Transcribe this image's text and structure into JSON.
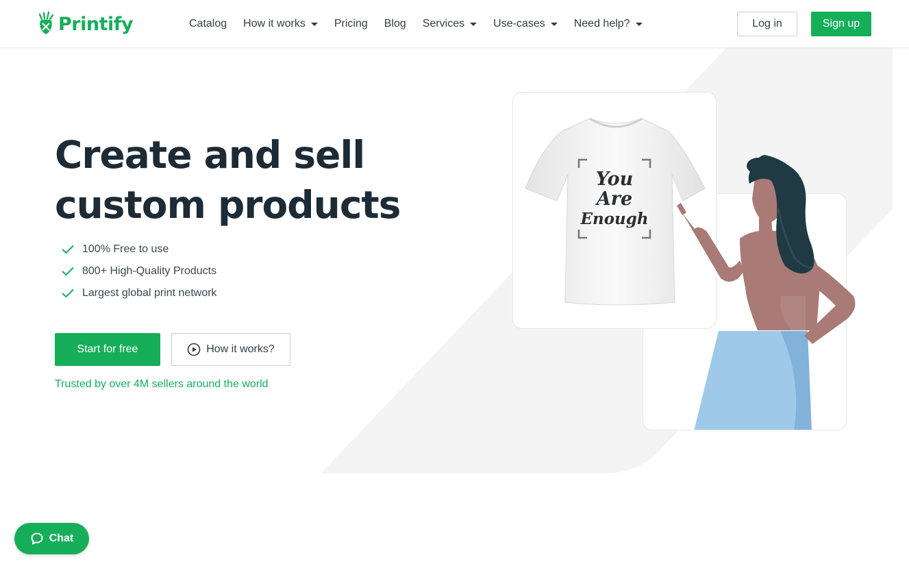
{
  "brand": {
    "name": "Printify",
    "color": "#17ae5a"
  },
  "nav": {
    "items": [
      {
        "label": "Catalog",
        "has_dropdown": false
      },
      {
        "label": "How it works",
        "has_dropdown": true
      },
      {
        "label": "Pricing",
        "has_dropdown": false
      },
      {
        "label": "Blog",
        "has_dropdown": false
      },
      {
        "label": "Services",
        "has_dropdown": true
      },
      {
        "label": "Use-cases",
        "has_dropdown": true
      },
      {
        "label": "Need help?",
        "has_dropdown": true
      }
    ],
    "login_label": "Log in",
    "signup_label": "Sign up"
  },
  "hero": {
    "title_line1": "Create and sell",
    "title_line2": "custom products",
    "features": [
      "100% Free to use",
      "800+ High-Quality Products",
      "Largest global print network"
    ],
    "primary_cta": "Start for free",
    "secondary_cta": "How it works?",
    "trusted_text": "Trusted by over 4M sellers around the world"
  },
  "illustration": {
    "shirt_print": [
      "You",
      "Are",
      "Enough"
    ]
  },
  "chat": {
    "label": "Chat"
  }
}
